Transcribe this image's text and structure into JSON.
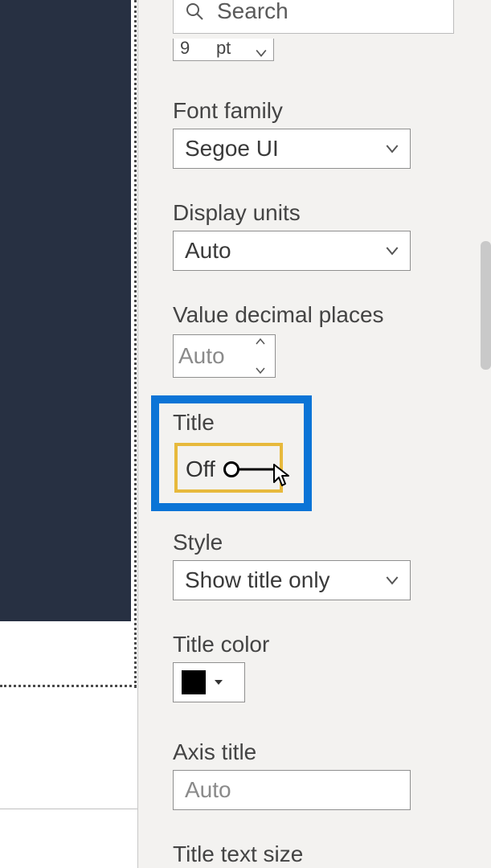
{
  "search": {
    "placeholder": "Search"
  },
  "font_size": {
    "value": "9",
    "unit": "pt"
  },
  "font_family": {
    "label": "Font family",
    "value": "Segoe UI"
  },
  "display_units": {
    "label": "Display units",
    "value": "Auto"
  },
  "value_decimal_places": {
    "label": "Value decimal places",
    "value": "Auto"
  },
  "title_toggle": {
    "label": "Title",
    "state": "Off"
  },
  "style": {
    "label": "Style",
    "value": "Show title only"
  },
  "title_color": {
    "label": "Title color",
    "value": "#000000"
  },
  "axis_title": {
    "label": "Axis title",
    "value": "Auto"
  },
  "title_text_size": {
    "label": "Title text size"
  }
}
